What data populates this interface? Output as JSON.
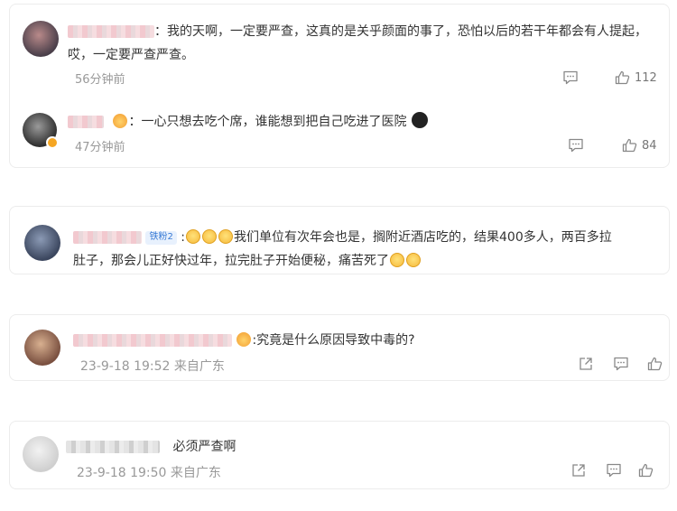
{
  "comments": [
    {
      "text_line1": "：我的天啊，一定要严查，这真的是关乎颜面的事了，恐怕以后的若干年都会有人提起，",
      "text_line2": "哎，一定要严查严查。",
      "time": "56分钟前",
      "like_count": "112",
      "reply": {
        "text": "：一心只想去吃个席，谁能想到把自己吃进了医院",
        "time": "47分钟前",
        "like_count": "84"
      }
    },
    {
      "badge": "铁粉2",
      "text_line1": "我们单位有次年会也是，搁附近酒店吃的，结果400多人，两百多拉",
      "text_line2": "肚子，那会儿正好快过年，拉完肚子开始便秘，痛苦死了"
    },
    {
      "text": ":究竟是什么原因导致中毒的?",
      "time": "23-9-18 19:52 来自广东"
    },
    {
      "text": "必须严查啊",
      "time": "23-9-18 19:50 来自广东"
    }
  ],
  "icons": {
    "comment": "comment-icon",
    "like": "thumbs-up-icon",
    "share": "share-icon"
  }
}
